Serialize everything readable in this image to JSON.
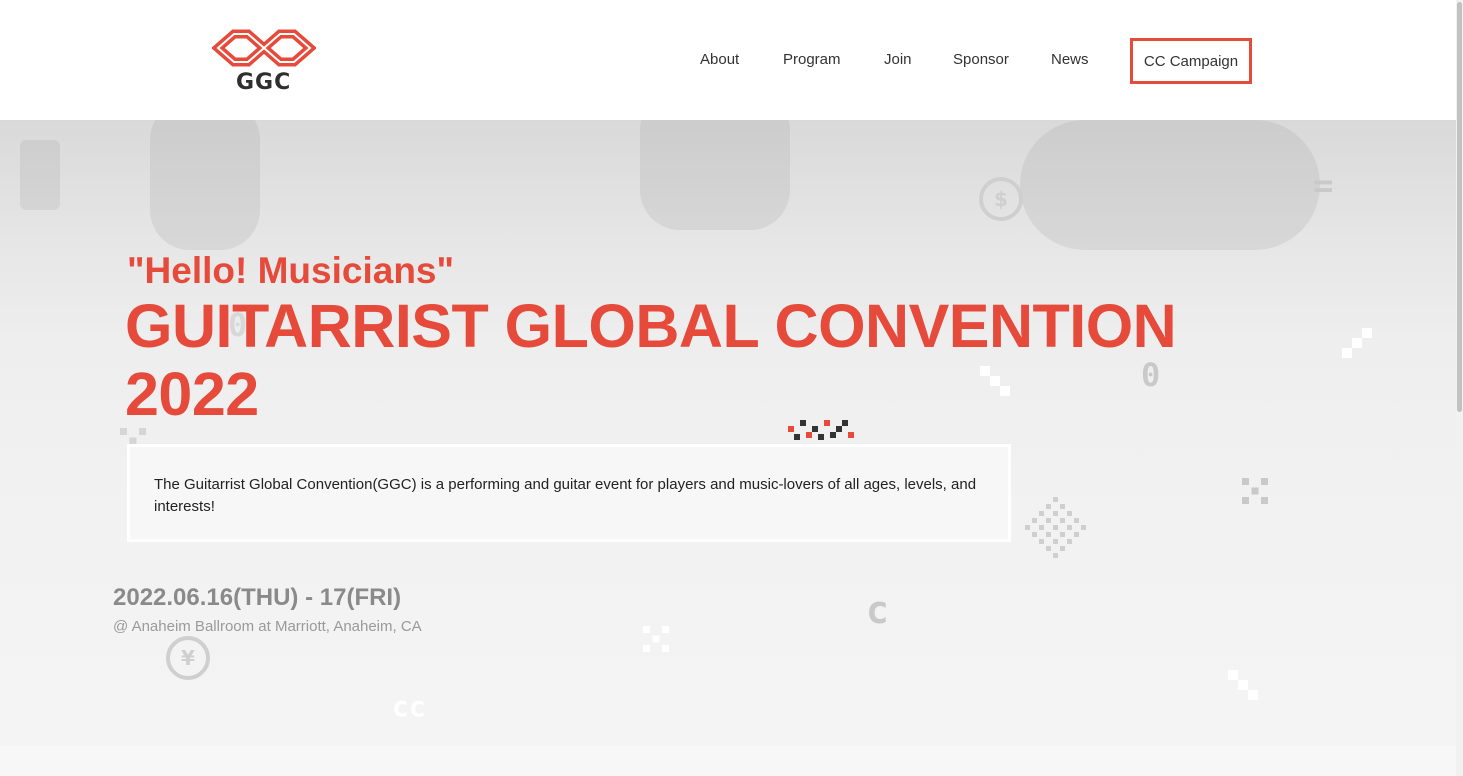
{
  "brand": {
    "logo_text": "GGC",
    "accent_color": "#e64a3b"
  },
  "nav": {
    "about": "About",
    "program": "Program",
    "join": "Join",
    "sponsor": "Sponsor",
    "news": "News",
    "campaign": "CC Campaign"
  },
  "hero": {
    "tagline": "\"Hello! Musicians\"",
    "headline_line1": "GUITARRIST GLOBAL CONVENTION",
    "headline_line2": "2022",
    "description": "The Guitarrist Global Convention(GGC) is a performing and guitar event for players and music-lovers of all ages, levels, and interests!",
    "date": "2022.06.16(THU) - 17(FRI)",
    "venue": "@ Anaheim Ballroom at Marriott, Anaheim, CA"
  },
  "decorations": {
    "dollar_coin": "$",
    "yen_coin": "¥",
    "zero_glyph": "0",
    "cc_glyph": "cc",
    "c_glyph": "c",
    "equals_glyph": "="
  }
}
